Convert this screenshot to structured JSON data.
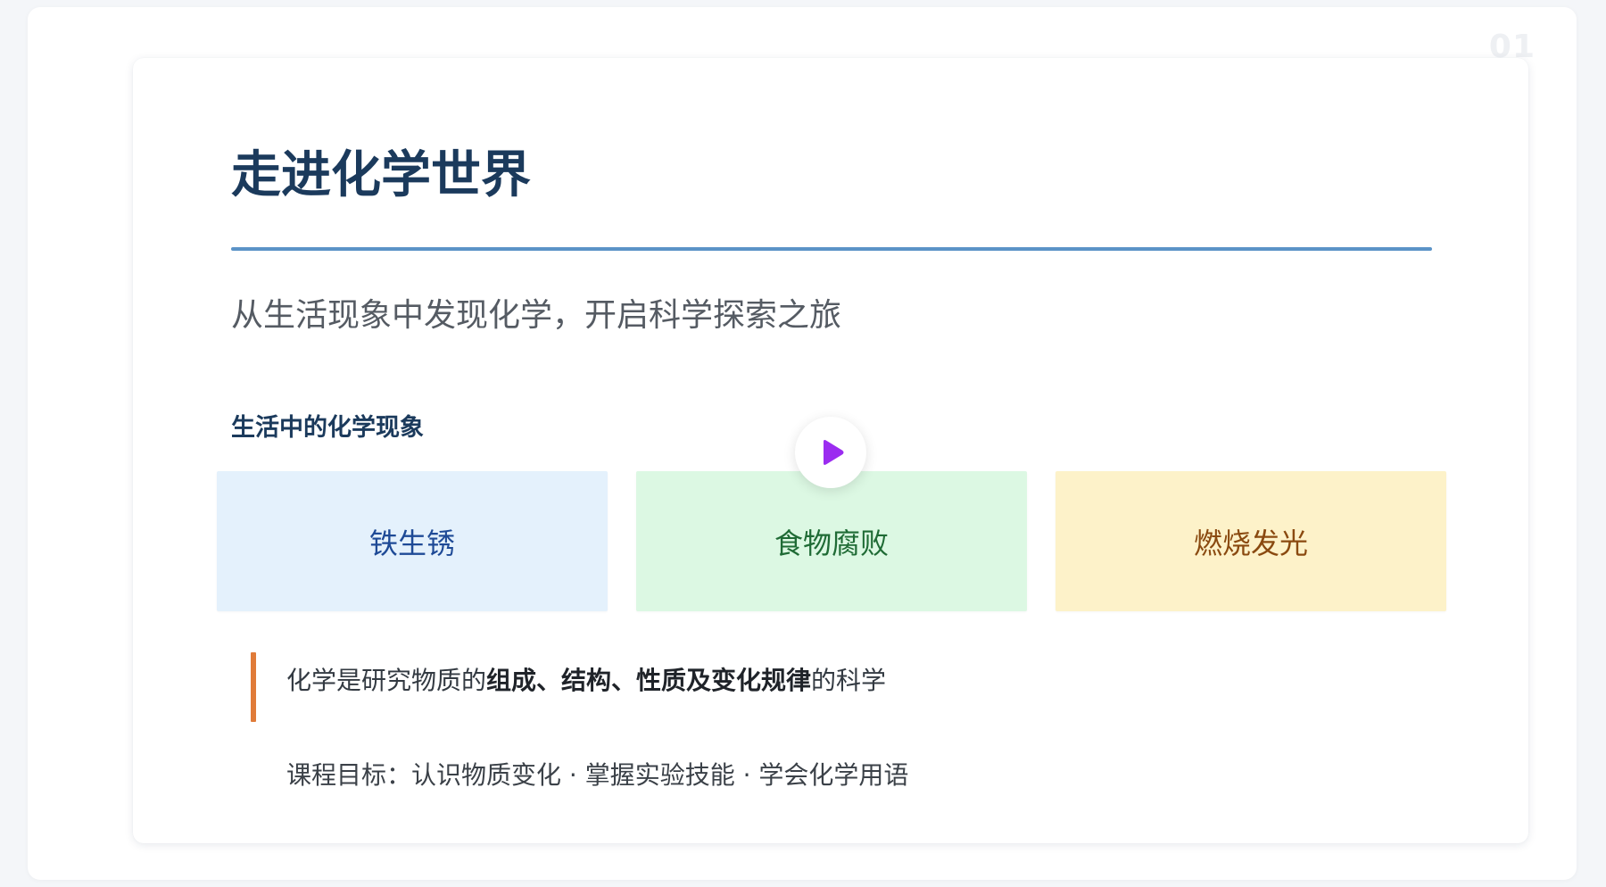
{
  "slide": {
    "number": "01",
    "title": "走进化学世界",
    "subtitle": "从生活现象中发现化学，开启科学探索之旅",
    "section_heading": "生活中的化学现象",
    "cards": [
      {
        "label": "铁生锈"
      },
      {
        "label": "食物腐败"
      },
      {
        "label": "燃烧发光"
      }
    ],
    "definition": {
      "prefix": "化学是研究物质的",
      "emphasis": "组成、结构、性质及变化规律",
      "suffix": "的科学"
    },
    "goals": "课程目标：认识物质变化 · 掌握实验技能 · 学会化学用语"
  },
  "media": {
    "play_icon": "play-icon"
  },
  "colors": {
    "title": "#1b3a5c",
    "rule": "#5b93c7",
    "accent_bar": "#e07b39",
    "play": "#9b2cf0",
    "card_blue_bg": "#e4f1fc",
    "card_green_bg": "#dcf8e3",
    "card_yellow_bg": "#fdf2c9"
  }
}
